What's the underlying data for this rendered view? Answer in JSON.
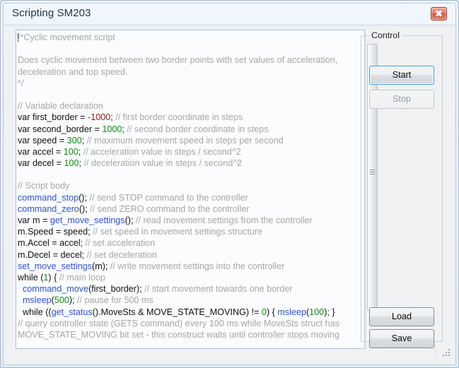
{
  "window": {
    "title": "Scripting SM203",
    "close_icon": "close-icon",
    "close_glyph": "✖"
  },
  "editor": {
    "name": "script-editor",
    "caret_visible": true,
    "lines": [
      [
        {
          "t": "/*Cyclic movement script",
          "c": "cmt",
          "caret": true
        }
      ],
      [],
      [
        {
          "t": "Does cyclic movement between two border points with set values of acceleration,",
          "c": "cmt"
        }
      ],
      [
        {
          "t": "deceleration and top speed.",
          "c": "cmt"
        }
      ],
      [
        {
          "t": "*/",
          "c": "cmt"
        }
      ],
      [],
      [
        {
          "t": "// Variable declaration",
          "c": "cmt"
        }
      ],
      [
        {
          "t": "var first_border = ",
          "c": "kw"
        },
        {
          "t": "-1000",
          "c": "numneg"
        },
        {
          "t": "; ",
          "c": "kw"
        },
        {
          "t": "// first border coordinate in steps",
          "c": "cmt"
        }
      ],
      [
        {
          "t": "var second_border = ",
          "c": "kw"
        },
        {
          "t": "1000",
          "c": "num"
        },
        {
          "t": "; ",
          "c": "kw"
        },
        {
          "t": "// second border coordinate in steps",
          "c": "cmt"
        }
      ],
      [
        {
          "t": "var speed = ",
          "c": "kw"
        },
        {
          "t": "300",
          "c": "num"
        },
        {
          "t": "; ",
          "c": "kw"
        },
        {
          "t": "// maximum movement speed in steps per second",
          "c": "cmt"
        }
      ],
      [
        {
          "t": "var accel = ",
          "c": "kw"
        },
        {
          "t": "100",
          "c": "num"
        },
        {
          "t": "; ",
          "c": "kw"
        },
        {
          "t": "// acceleration value in steps / second^2",
          "c": "cmt"
        }
      ],
      [
        {
          "t": "var decel = ",
          "c": "kw"
        },
        {
          "t": "100",
          "c": "num"
        },
        {
          "t": "; ",
          "c": "kw"
        },
        {
          "t": "// deceleration value in steps / second^2",
          "c": "cmt"
        }
      ],
      [],
      [
        {
          "t": "// Script body",
          "c": "cmt"
        }
      ],
      [
        {
          "t": "command_stop",
          "c": "fn"
        },
        {
          "t": "(); ",
          "c": "kw"
        },
        {
          "t": "// send STOP command to the controller",
          "c": "cmt"
        }
      ],
      [
        {
          "t": "command_zero",
          "c": "fn"
        },
        {
          "t": "(); ",
          "c": "kw"
        },
        {
          "t": "// send ZERO command to the controller",
          "c": "cmt"
        }
      ],
      [
        {
          "t": "var m = ",
          "c": "kw"
        },
        {
          "t": "get_move_settings",
          "c": "fn"
        },
        {
          "t": "(); ",
          "c": "kw"
        },
        {
          "t": "// read movement settings from the controller",
          "c": "cmt"
        }
      ],
      [
        {
          "t": "m.Speed = speed; ",
          "c": "kw"
        },
        {
          "t": "// set speed in movement settings structure",
          "c": "cmt"
        }
      ],
      [
        {
          "t": "m.Accel = accel; ",
          "c": "kw"
        },
        {
          "t": "// set acceleration",
          "c": "cmt"
        }
      ],
      [
        {
          "t": "m.Decel = decel; ",
          "c": "kw"
        },
        {
          "t": "// set deceleration",
          "c": "cmt"
        }
      ],
      [
        {
          "t": "set_move_settings",
          "c": "fn"
        },
        {
          "t": "(m); ",
          "c": "kw"
        },
        {
          "t": "// write movement settings into the controller",
          "c": "cmt"
        }
      ],
      [
        {
          "t": "while (",
          "c": "kw"
        },
        {
          "t": "1",
          "c": "num"
        },
        {
          "t": ") { ",
          "c": "kw"
        },
        {
          "t": "// main loop",
          "c": "cmt"
        }
      ],
      [
        {
          "t": "  ",
          "c": "kw"
        },
        {
          "t": "command_move",
          "c": "fn"
        },
        {
          "t": "(first_border); ",
          "c": "kw"
        },
        {
          "t": "// start movement towards one border",
          "c": "cmt"
        }
      ],
      [
        {
          "t": "  ",
          "c": "kw"
        },
        {
          "t": "msleep",
          "c": "fn"
        },
        {
          "t": "(",
          "c": "kw"
        },
        {
          "t": "500",
          "c": "num"
        },
        {
          "t": "); ",
          "c": "kw"
        },
        {
          "t": "// pause for 500 ms",
          "c": "cmt"
        }
      ],
      [
        {
          "t": "  while ((",
          "c": "kw"
        },
        {
          "t": "get_status",
          "c": "fn"
        },
        {
          "t": "().MoveSts & MOVE_STATE_MOVING) != ",
          "c": "kw"
        },
        {
          "t": "0",
          "c": "num"
        },
        {
          "t": ") { ",
          "c": "kw"
        },
        {
          "t": "msleep",
          "c": "fn"
        },
        {
          "t": "(",
          "c": "kw"
        },
        {
          "t": "100",
          "c": "num"
        },
        {
          "t": "); }",
          "c": "kw"
        }
      ],
      [
        {
          "t": "// query controller state (GETS command) every 100 ms while MoveSts struct has",
          "c": "cmt"
        }
      ],
      [
        {
          "t": "MOVE_STATE_MOVING bit set - this construct waits until controller stops moving",
          "c": "cmt"
        }
      ]
    ]
  },
  "scrollbar": {
    "up_icon": "scroll-up-arrow-icon",
    "down_icon": "scroll-down-arrow-icon",
    "thumb": "scroll-thumb"
  },
  "control_group": {
    "legend": "Control",
    "buttons": [
      {
        "label": "Start",
        "state": "focused"
      },
      {
        "label": "Stop",
        "state": "disabled"
      },
      {
        "label": "Load",
        "state": "normal"
      },
      {
        "label": "Save",
        "state": "normal"
      }
    ]
  },
  "colors": {
    "comment": "#a6a6a6",
    "function": "#2a52d6",
    "number_positive": "#0f8a18",
    "number_negative": "#9b1212",
    "code": "#101010",
    "accent_focus": "#3c9fd6",
    "close_button": "#d4583f"
  }
}
